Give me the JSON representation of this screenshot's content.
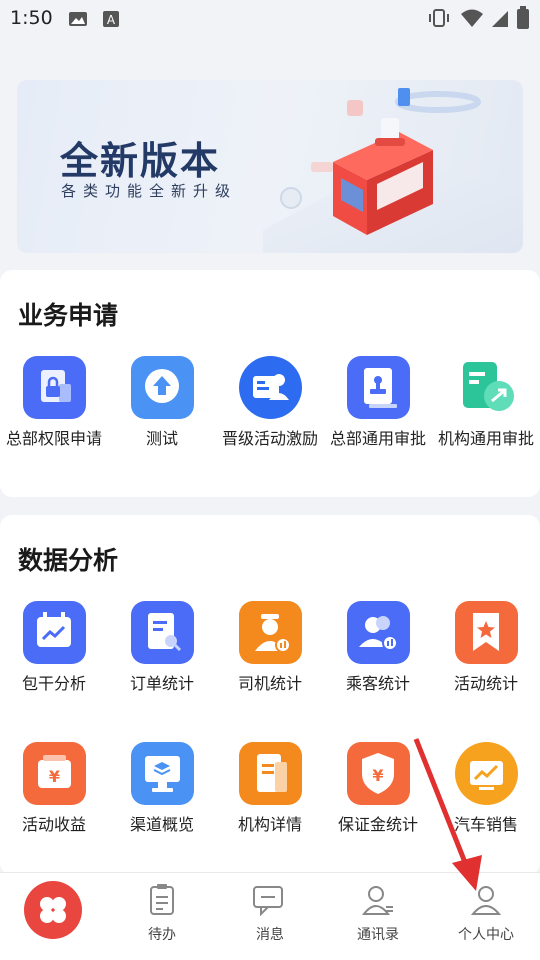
{
  "status_bar": {
    "time": "1:50"
  },
  "banner": {
    "title": "全新版本",
    "subtitle": "各类功能全新升级"
  },
  "apply_section": {
    "title": "业务申请",
    "items": [
      {
        "label": "总部权限申请",
        "icon": "lock-doc-icon",
        "color": "#4a6cf7"
      },
      {
        "label": "测试",
        "icon": "upload-arrow-icon",
        "color": "#4a93f5"
      },
      {
        "label": "晋级活动激励",
        "icon": "id-card-person-icon",
        "color": "#2d6cf0"
      },
      {
        "label": "总部通用审批",
        "icon": "stamp-doc-icon",
        "color": "#4a6cf7"
      },
      {
        "label": "机构通用审批",
        "icon": "approve-arrow-icon",
        "color": "#2cc59a"
      }
    ]
  },
  "data_section": {
    "title": "数据分析",
    "items": [
      {
        "label": "包干分析",
        "icon": "calendar-chart-icon",
        "color": "#4a6cf7"
      },
      {
        "label": "订单统计",
        "icon": "order-search-icon",
        "color": "#4a6cf7"
      },
      {
        "label": "司机统计",
        "icon": "driver-chart-icon",
        "color": "#f48a1e"
      },
      {
        "label": "乘客统计",
        "icon": "passengers-chart-icon",
        "color": "#4a6cf7"
      },
      {
        "label": "活动统计",
        "icon": "star-bookmark-icon",
        "color": "#f46a3c"
      },
      {
        "label": "活动收益",
        "icon": "yuan-wallet-icon",
        "color": "#f46a3c"
      },
      {
        "label": "渠道概览",
        "icon": "channel-monitor-icon",
        "color": "#4a93f5"
      },
      {
        "label": "机构详情",
        "icon": "building-doc-icon",
        "color": "#f48a1e"
      },
      {
        "label": "保证金统计",
        "icon": "yuan-shield-icon",
        "color": "#f46a3c"
      },
      {
        "label": "汽车销售",
        "icon": "car-sales-chart-icon",
        "color": "#f6a21e"
      }
    ]
  },
  "bottom_nav": {
    "items": [
      {
        "label": "",
        "icon": "home-grid-icon"
      },
      {
        "label": "待办",
        "icon": "todo-list-icon"
      },
      {
        "label": "消息",
        "icon": "message-icon"
      },
      {
        "label": "通讯录",
        "icon": "contacts-icon"
      },
      {
        "label": "个人中心",
        "icon": "user-center-icon"
      }
    ]
  }
}
